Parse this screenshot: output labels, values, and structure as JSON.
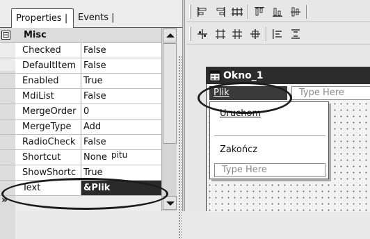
{
  "properties_panel": {
    "tabs": [
      {
        "label": "Properties |"
      },
      {
        "label": "Events |"
      }
    ],
    "category": {
      "label": "Misc",
      "expander": "⊟"
    },
    "rows": [
      {
        "name": "Checked",
        "value": "False"
      },
      {
        "name": "DefaultItem",
        "value": "False"
      },
      {
        "name": "Enabled",
        "value": "True"
      },
      {
        "name": "MdiList",
        "value": "False"
      },
      {
        "name": "MergeOrder",
        "value": "0"
      },
      {
        "name": "MergeType",
        "value": "Add"
      },
      {
        "name": "RadioCheck",
        "value": "False"
      },
      {
        "name": "Shortcut",
        "value": "None"
      },
      {
        "name": "ShowShortc",
        "value": "True"
      },
      {
        "name": "Text",
        "value": "&Plik"
      }
    ],
    "selected_row": "Text"
  },
  "designer": {
    "form_title": "Okno_1",
    "menubar": {
      "active_item": "Plik",
      "placeholder": "Type Here"
    },
    "dropdown": {
      "items": [
        {
          "label": "Uruchom"
        },
        {
          "label": "Zakończ"
        }
      ],
      "placeholder": "Type Here"
    },
    "partial_label": "pitu"
  },
  "colors": {
    "selection": "#2a2a2a",
    "title_bar": "#2c2c2c",
    "annotation_ellipse": "#1b1b1b"
  }
}
